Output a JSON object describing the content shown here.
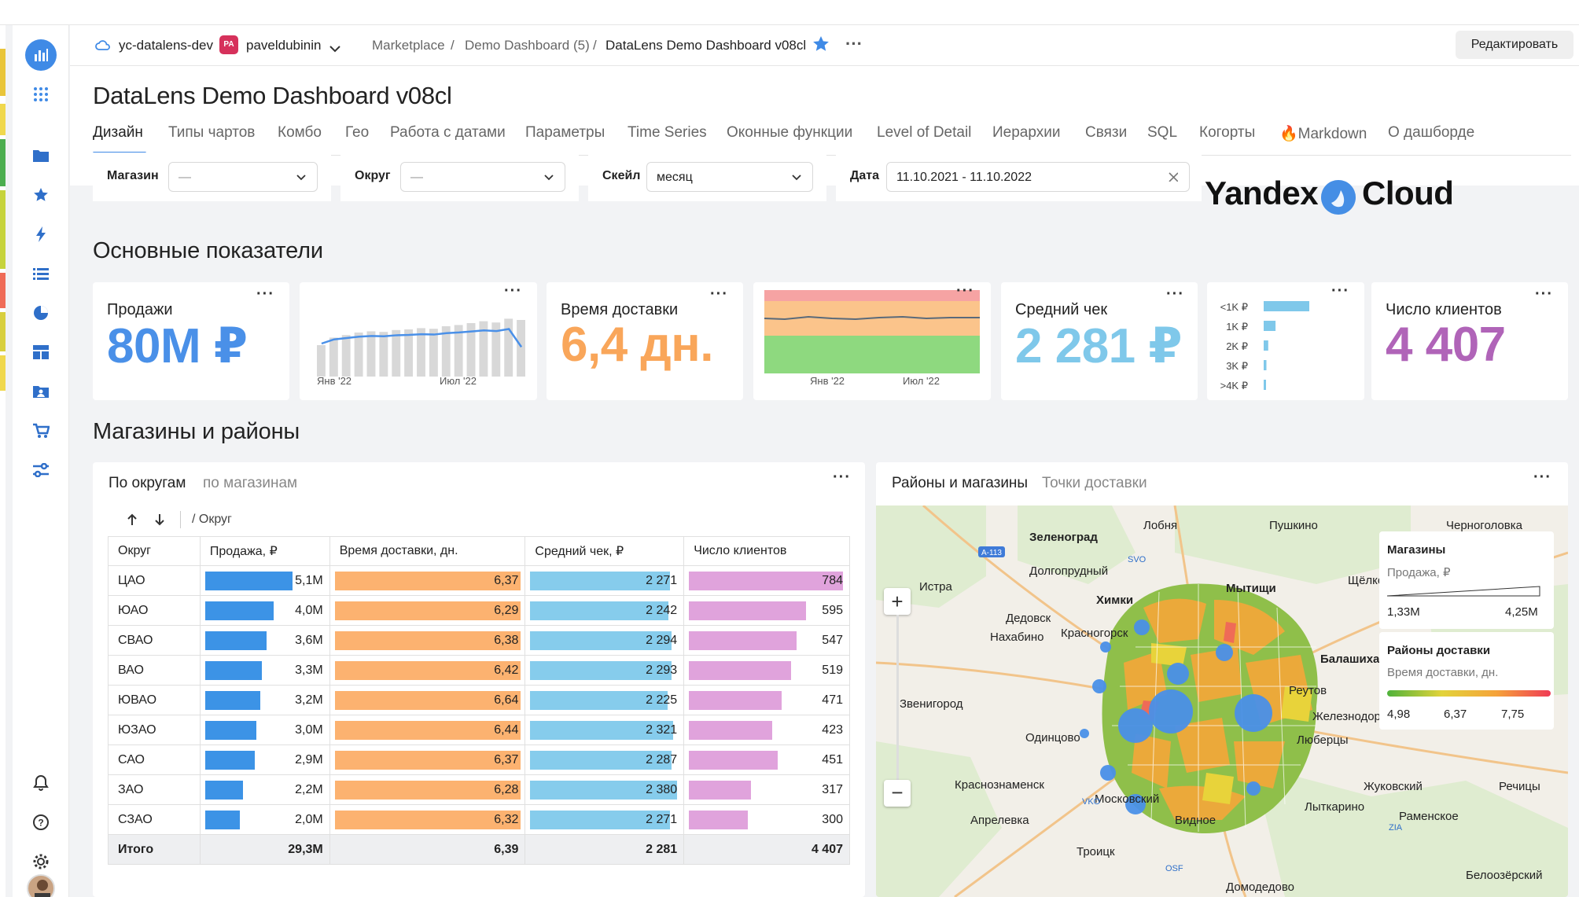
{
  "colors": {
    "accent": "#3f8ae6",
    "blue": "#4a90e8",
    "orange": "#f9a65a",
    "cyan": "#7fc8ea",
    "purple": "#b064b8",
    "sales_bar": "#3c93e6",
    "delivery_bar": "#fcb270",
    "check_bar": "#86ccec",
    "clients_bar": "#e0a3dc"
  },
  "sidebar": {
    "icons": [
      "dashboards-icon",
      "grid-menu-icon",
      "folder-icon",
      "star-icon",
      "lightning-icon",
      "list-icon",
      "pie-chart-icon",
      "layout-icon",
      "folder-person-icon",
      "cart-icon",
      "sliders-icon",
      "bell-icon",
      "help-icon",
      "gear-icon",
      "avatar"
    ]
  },
  "header": {
    "cloud": "yc-datalens-dev",
    "user_badge": "PA",
    "user": "paveldubinin",
    "crumbs": [
      "Marketplace",
      "Demo Dashboard (5)",
      "DataLens Demo Dashboard v08cl"
    ],
    "separator": "/",
    "more": "···",
    "edit_button": "Редактировать"
  },
  "page": {
    "title": "DataLens Demo Dashboard v08cl"
  },
  "tabs": [
    "Дизайн",
    "Типы чартов",
    "Комбо",
    "Гео",
    "Работа с датами",
    "Параметры",
    "Time Series",
    "Оконные функции",
    "Level of Detail",
    "Иерархии",
    "Связи",
    "SQL",
    "Когорты",
    "🔥Markdown",
    "О дашборде"
  ],
  "filters": {
    "shop": {
      "label": "Магазин",
      "value": "—"
    },
    "district": {
      "label": "Округ",
      "value": "—"
    },
    "scale": {
      "label": "Скейл",
      "value": "месяц"
    },
    "date": {
      "label": "Дата",
      "value": "11.10.2021 - 11.10.2022"
    }
  },
  "brand": {
    "left": "Yandex",
    "right": "Cloud"
  },
  "sections": {
    "kpi": "Основные показатели",
    "shops": "Магазины и районы"
  },
  "kpis": {
    "sales": {
      "label": "Продажи",
      "value": "80M ₽"
    },
    "delivery": {
      "label": "Время доставки",
      "value": "6,4 дн."
    },
    "check": {
      "label": "Средний чек",
      "value": "2 281 ₽"
    },
    "clients": {
      "label": "Число клиентов",
      "value": "4 407"
    }
  },
  "mini_axes": {
    "jan": "Янв '22",
    "jul": "Июл '22"
  },
  "check_hist": {
    "labels": [
      "<1K ₽",
      "1K ₽",
      "2K ₽",
      "3K ₽",
      ">4K ₽"
    ],
    "values": [
      100,
      26,
      10,
      6,
      3
    ]
  },
  "table": {
    "tab_active": "По округам",
    "tab_other": "по магазинам",
    "path": "/ Округ",
    "headers": [
      "Округ",
      "Продажа, ₽",
      "Время доставки, дн.",
      "Средний чек, ₽",
      "Число клиентов"
    ],
    "rows": [
      {
        "d": "ЦАО",
        "s": "5,1M",
        "sv": 5.1,
        "t": "6,37",
        "tv": 6.37,
        "c": "2 271",
        "cv": 2271,
        "n": "784",
        "nv": 784
      },
      {
        "d": "ЮАО",
        "s": "4,0M",
        "sv": 4.0,
        "t": "6,29",
        "tv": 6.29,
        "c": "2 242",
        "cv": 2242,
        "n": "595",
        "nv": 595
      },
      {
        "d": "СВАО",
        "s": "3,6M",
        "sv": 3.6,
        "t": "6,38",
        "tv": 6.38,
        "c": "2 294",
        "cv": 2294,
        "n": "547",
        "nv": 547
      },
      {
        "d": "ВАО",
        "s": "3,3M",
        "sv": 3.3,
        "t": "6,42",
        "tv": 6.42,
        "c": "2 293",
        "cv": 2293,
        "n": "519",
        "nv": 519
      },
      {
        "d": "ЮВАО",
        "s": "3,2M",
        "sv": 3.2,
        "t": "6,64",
        "tv": 6.64,
        "c": "2 225",
        "cv": 2225,
        "n": "471",
        "nv": 471
      },
      {
        "d": "ЮЗАО",
        "s": "3,0M",
        "sv": 3.0,
        "t": "6,44",
        "tv": 6.44,
        "c": "2 321",
        "cv": 2321,
        "n": "423",
        "nv": 423
      },
      {
        "d": "САО",
        "s": "2,9M",
        "sv": 2.9,
        "t": "6,37",
        "tv": 6.37,
        "c": "2 287",
        "cv": 2287,
        "n": "451",
        "nv": 451
      },
      {
        "d": "ЗАО",
        "s": "2,2M",
        "sv": 2.2,
        "t": "6,28",
        "tv": 6.28,
        "c": "2 380",
        "cv": 2380,
        "n": "317",
        "nv": 317
      },
      {
        "d": "СЗАО",
        "s": "2,0M",
        "sv": 2.0,
        "t": "6,32",
        "tv": 6.32,
        "c": "2 271",
        "cv": 2271,
        "n": "300",
        "nv": 300
      }
    ],
    "total": {
      "d": "Итого",
      "s": "29,3M",
      "t": "6,39",
      "c": "2 281",
      "n": "4 407"
    }
  },
  "map": {
    "tab_active": "Районы и магазины",
    "tab_other": "Точки доставки",
    "places": [
      "Зеленоград",
      "Лобня",
      "Пушкино",
      "Черноголовка",
      "Истра",
      "Долгопрудный",
      "Химки",
      "Мытищи",
      "Щёлково",
      "Дедовск",
      "Нахабино",
      "Красногорск",
      "Балашиха",
      "Реутов",
      "Звенигород",
      "Одинцово",
      "Железнодорожный",
      "Люберцы",
      "Краснознаменск",
      "Московский",
      "Видное",
      "Лыткарино",
      "Жуковский",
      "Раменское",
      "Апрелевка",
      "Троицк",
      "Речицы",
      "Белоозёрский",
      "Домодедово",
      "SVO",
      "VKO",
      "ZIA",
      "OSF",
      "A-113"
    ],
    "legend_shops_title": "Магазины",
    "legend_shops_metric": "Продажа, ₽",
    "legend_shops_min": "1,33M",
    "legend_shops_max": "4,25M",
    "legend_areas_title": "Районы доставки",
    "legend_areas_metric": "Время доставки, дн.",
    "legend_areas_ticks": [
      "4,98",
      "6,37",
      "7,75"
    ],
    "zoom_in": "+",
    "zoom_out": "−"
  }
}
